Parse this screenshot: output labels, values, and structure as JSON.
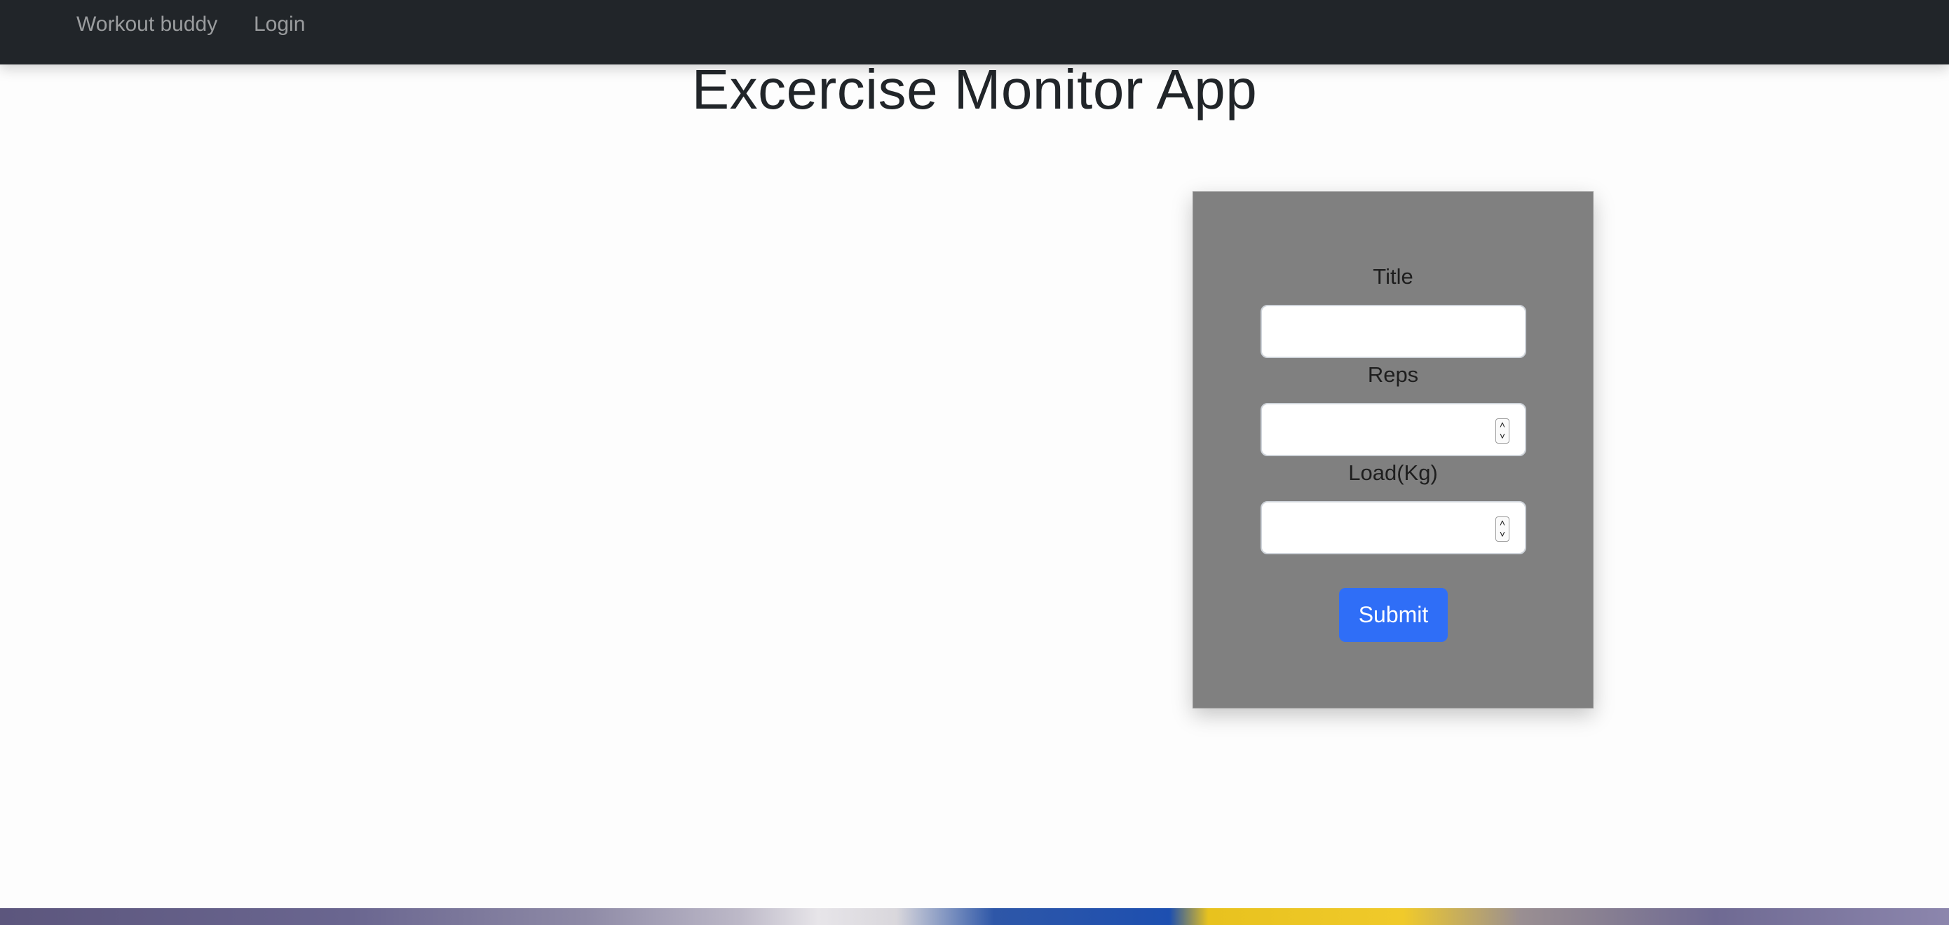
{
  "navbar": {
    "brand": "Workout buddy",
    "login": "Login",
    "background": "#212529"
  },
  "page": {
    "title": "Excercise Monitor App"
  },
  "form": {
    "background": "#808080",
    "fields": [
      {
        "label": "Title",
        "value": "",
        "type": "text"
      },
      {
        "label": "Reps",
        "value": "",
        "type": "number"
      },
      {
        "label": "Load(Kg)",
        "value": "",
        "type": "number"
      }
    ],
    "submit_label": "Submit",
    "submit_color": "#2f6ef7"
  }
}
